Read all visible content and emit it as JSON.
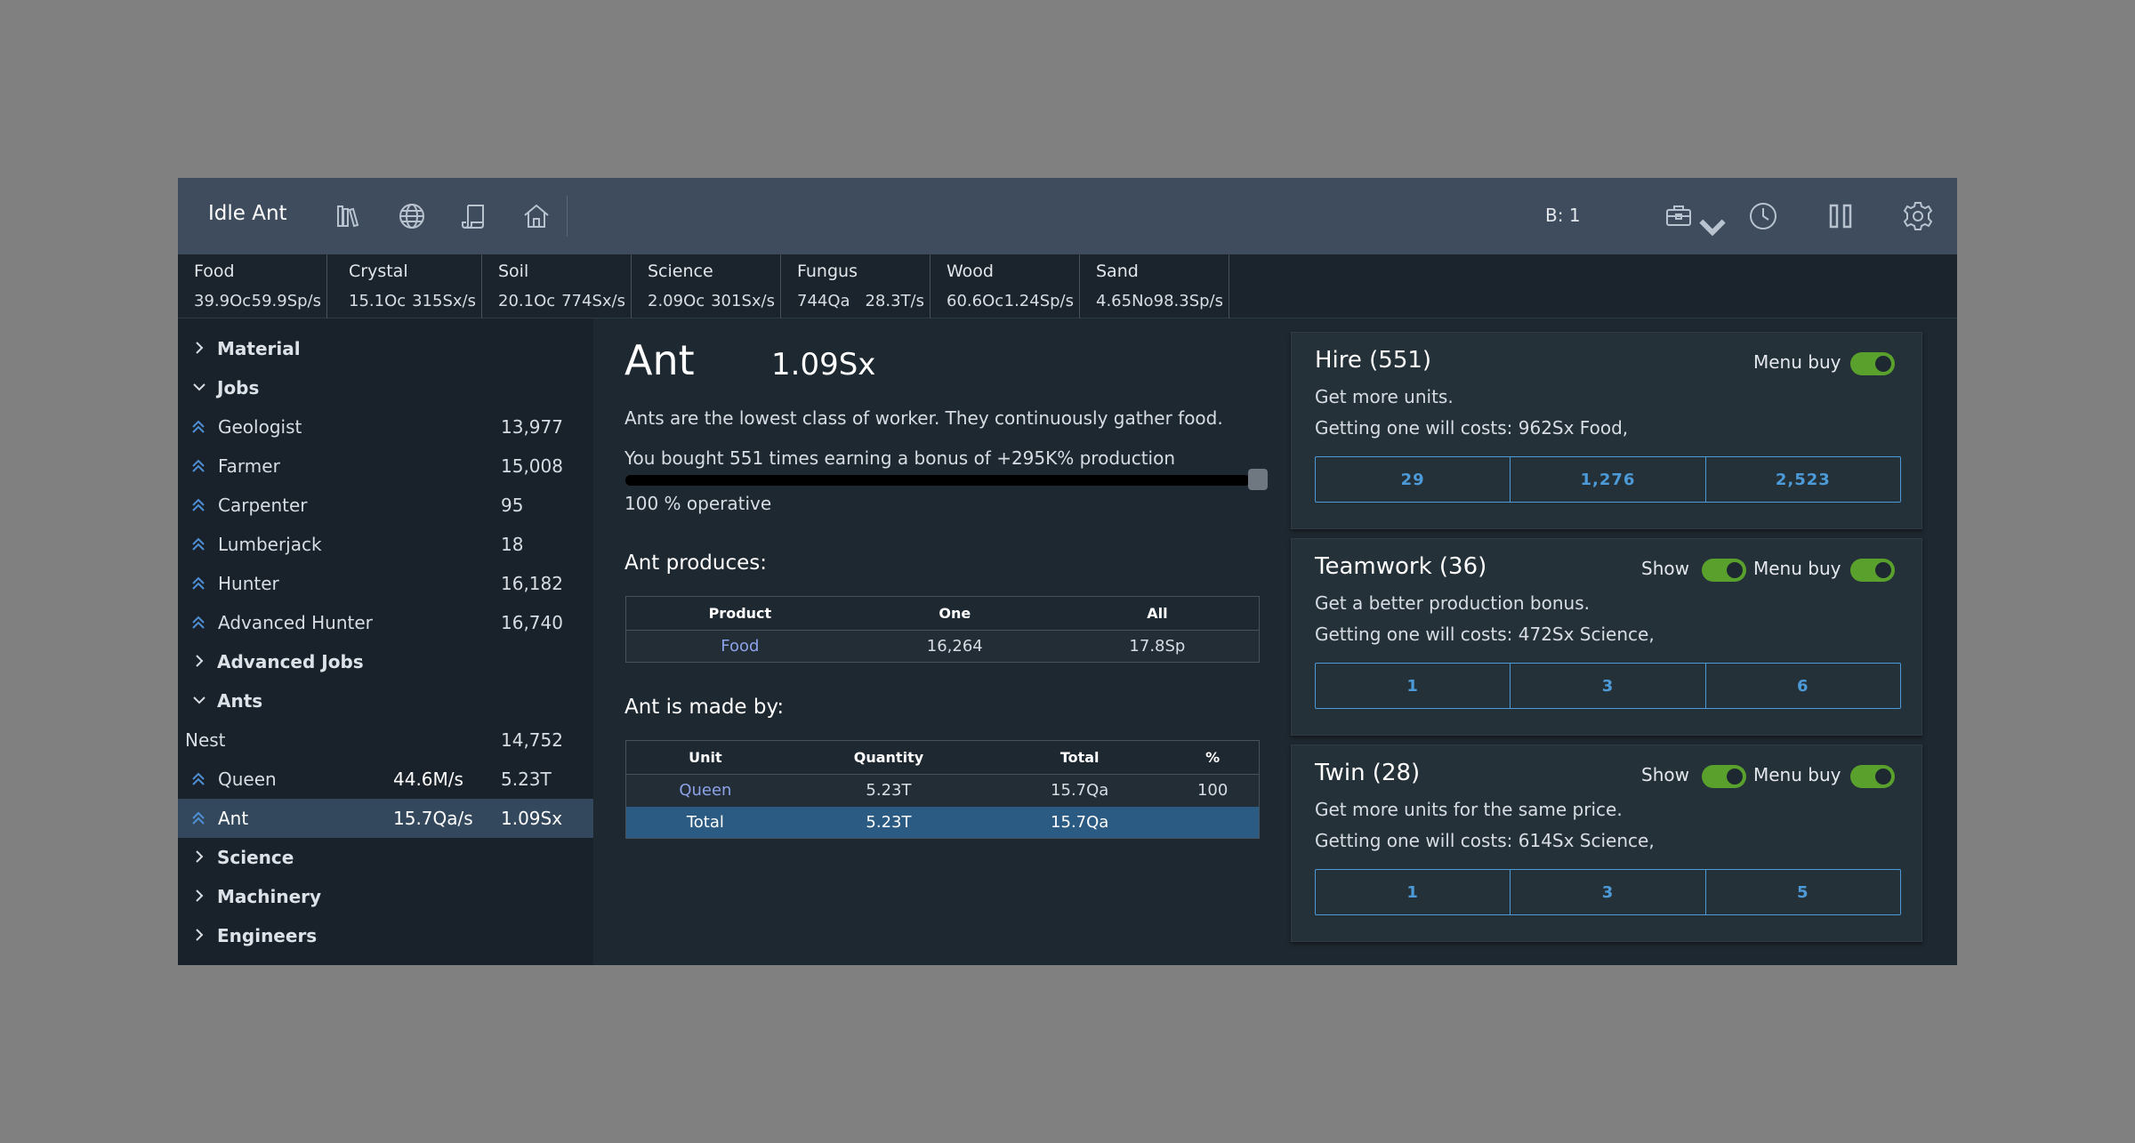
{
  "app": {
    "title": "Idle Ant"
  },
  "nav": {
    "icons": [
      "library-icon",
      "globe-icon",
      "scroll-icon",
      "home-icon"
    ]
  },
  "header": {
    "buy_multiplier": "B: 1",
    "icons": [
      "toolbox-icon",
      "history-icon",
      "pause-icon",
      "gear-icon"
    ]
  },
  "resources": [
    {
      "name": "Food",
      "amount": "39.9Oc",
      "rate": "59.9Sp/s"
    },
    {
      "name": "Crystal",
      "amount": "15.1Oc",
      "rate": "315Sx/s"
    },
    {
      "name": "Soil",
      "amount": "20.1Oc",
      "rate": "774Sx/s"
    },
    {
      "name": "Science",
      "amount": "2.09Oc",
      "rate": "301Sx/s"
    },
    {
      "name": "Fungus",
      "amount": "744Qa",
      "rate": "28.3T/s"
    },
    {
      "name": "Wood",
      "amount": "60.6Oc",
      "rate": "1.24Sp/s"
    },
    {
      "name": "Sand",
      "amount": "4.65No",
      "rate": "98.3Sp/s"
    }
  ],
  "sidebar": {
    "material": "Material",
    "jobs": "Jobs",
    "job_items": [
      {
        "label": "Geologist",
        "count": "13,977"
      },
      {
        "label": "Farmer",
        "count": "15,008"
      },
      {
        "label": "Carpenter",
        "count": "95"
      },
      {
        "label": "Lumberjack",
        "count": "18"
      },
      {
        "label": "Hunter",
        "count": "16,182"
      },
      {
        "label": "Advanced Hunter",
        "count": "16,740"
      }
    ],
    "advanced_jobs": "Advanced Jobs",
    "ants": "Ants",
    "nest": {
      "label": "Nest",
      "count": "14,752"
    },
    "queen": {
      "label": "Queen",
      "rate": "44.6M/s",
      "count": "5.23T"
    },
    "ant": {
      "label": "Ant",
      "rate": "15.7Qa/s",
      "count": "1.09Sx"
    },
    "science": "Science",
    "machinery": "Machinery",
    "engineers": "Engineers"
  },
  "unit": {
    "name": "Ant",
    "quantity": "1.09Sx",
    "description": "Ants are the lowest class of worker. They continuously gather food.",
    "bonus_text": "You bought 551 times earning a bonus of +295K% production",
    "operative_percent": 100,
    "operative_text": "100 % operative",
    "produces_heading": "Ant produces:",
    "produces_table": {
      "headers": [
        "Product",
        "One",
        "All"
      ],
      "rows": [
        {
          "product": "Food",
          "one": "16,264",
          "all": "17.8Sp"
        }
      ]
    },
    "made_by_heading": "Ant is made by:",
    "made_by_table": {
      "headers": [
        "Unit",
        "Quantity",
        "Total",
        "%"
      ],
      "rows": [
        {
          "unit": "Queen",
          "quantity": "5.23T",
          "total": "15.7Qa",
          "percent": "100"
        }
      ],
      "total_row": {
        "label": "Total",
        "quantity": "5.23T",
        "total": "15.7Qa"
      }
    }
  },
  "cards": {
    "hire": {
      "title": "Hire (551)",
      "menu_buy_label": "Menu buy",
      "description": "Get more units.",
      "cost": "Getting one will costs: 962Sx Food,",
      "buttons": [
        "29",
        "1,276",
        "2,523"
      ]
    },
    "teamwork": {
      "title": "Teamwork (36)",
      "show_label": "Show",
      "menu_buy_label": "Menu buy",
      "description": "Get a better production bonus.",
      "cost": "Getting one will costs: 472Sx Science,",
      "buttons": [
        "1",
        "3",
        "6"
      ]
    },
    "twin": {
      "title": "Twin (28)",
      "show_label": "Show",
      "menu_buy_label": "Menu buy",
      "description": "Get more units for the same price.",
      "cost": "Getting one will costs: 614Sx Science,",
      "buttons": [
        "1",
        "3",
        "5"
      ]
    }
  },
  "colors": {
    "toggle_on": "#5aa02c",
    "accent_blue": "#4c9ad8",
    "selected_row": "#2b5a82",
    "header_bg": "#3e4c5e"
  }
}
